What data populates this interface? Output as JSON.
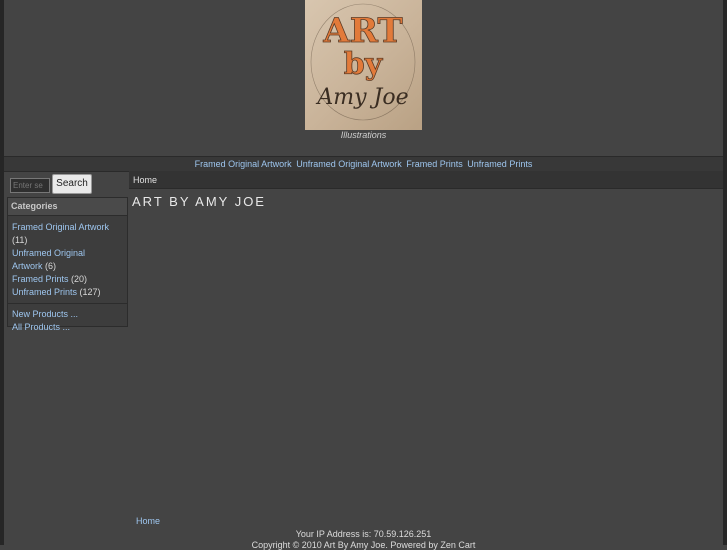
{
  "header": {
    "logo_text": "ART by Amy Joe",
    "tagline": "Illustrations"
  },
  "topnav": {
    "links": [
      "Framed Original Artwork",
      "Unframed Original Artwork",
      "Framed Prints",
      "Unframed Prints"
    ]
  },
  "search": {
    "placeholder": "Enter se",
    "button_label": "Search"
  },
  "categories": {
    "heading": "Categories",
    "items": [
      {
        "label": "Framed Original Artwork",
        "count": "(11)"
      },
      {
        "label_line1": "Unframed Original",
        "label_line2": "Artwork",
        "count": "(6)"
      },
      {
        "label": "Framed Prints",
        "count": "(20)"
      },
      {
        "label": "Unframed Prints",
        "count": "(127)"
      }
    ],
    "links": [
      "New Products ...",
      "All Products ..."
    ]
  },
  "breadcrumb": "Home",
  "main": {
    "title": "ART BY AMY JOE"
  },
  "footer": {
    "home_link": "Home",
    "ip_text": "Your IP Address is: 70.59.126.251",
    "copyright": "Copyright © 2010 Art By Amy Joe. Powered by Zen Cart"
  }
}
